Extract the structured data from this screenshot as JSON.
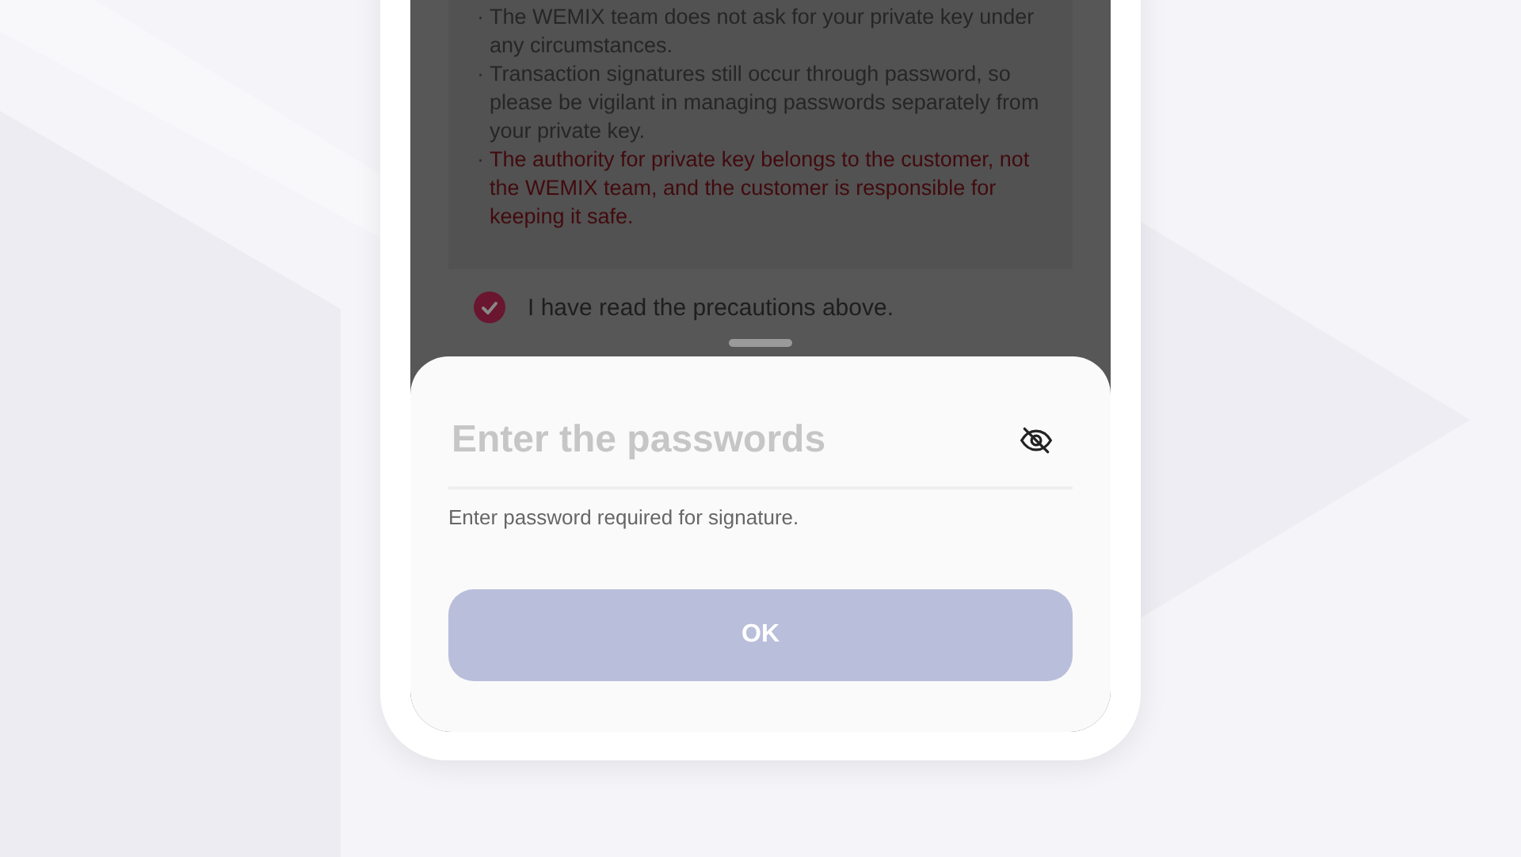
{
  "precautions": [
    {
      "text": "The WEMIX team does not ask for your private key under any circumstances.",
      "kind": "normal"
    },
    {
      "text": "Transaction signatures still occur through password, so please be vigilant in managing passwords separately from your private key.",
      "kind": "normal"
    },
    {
      "text": "The authority for private key belongs to the customer, not the WEMIX team, and the customer is responsible for keeping it safe.",
      "kind": "warning"
    }
  ],
  "bullet": "·",
  "agreement": {
    "label": "I have read the precautions above.",
    "checked": true
  },
  "password_sheet": {
    "placeholder": "Enter the passwords",
    "hint": "Enter password required for signature.",
    "ok_button": "OK",
    "ok_disabled": true
  }
}
